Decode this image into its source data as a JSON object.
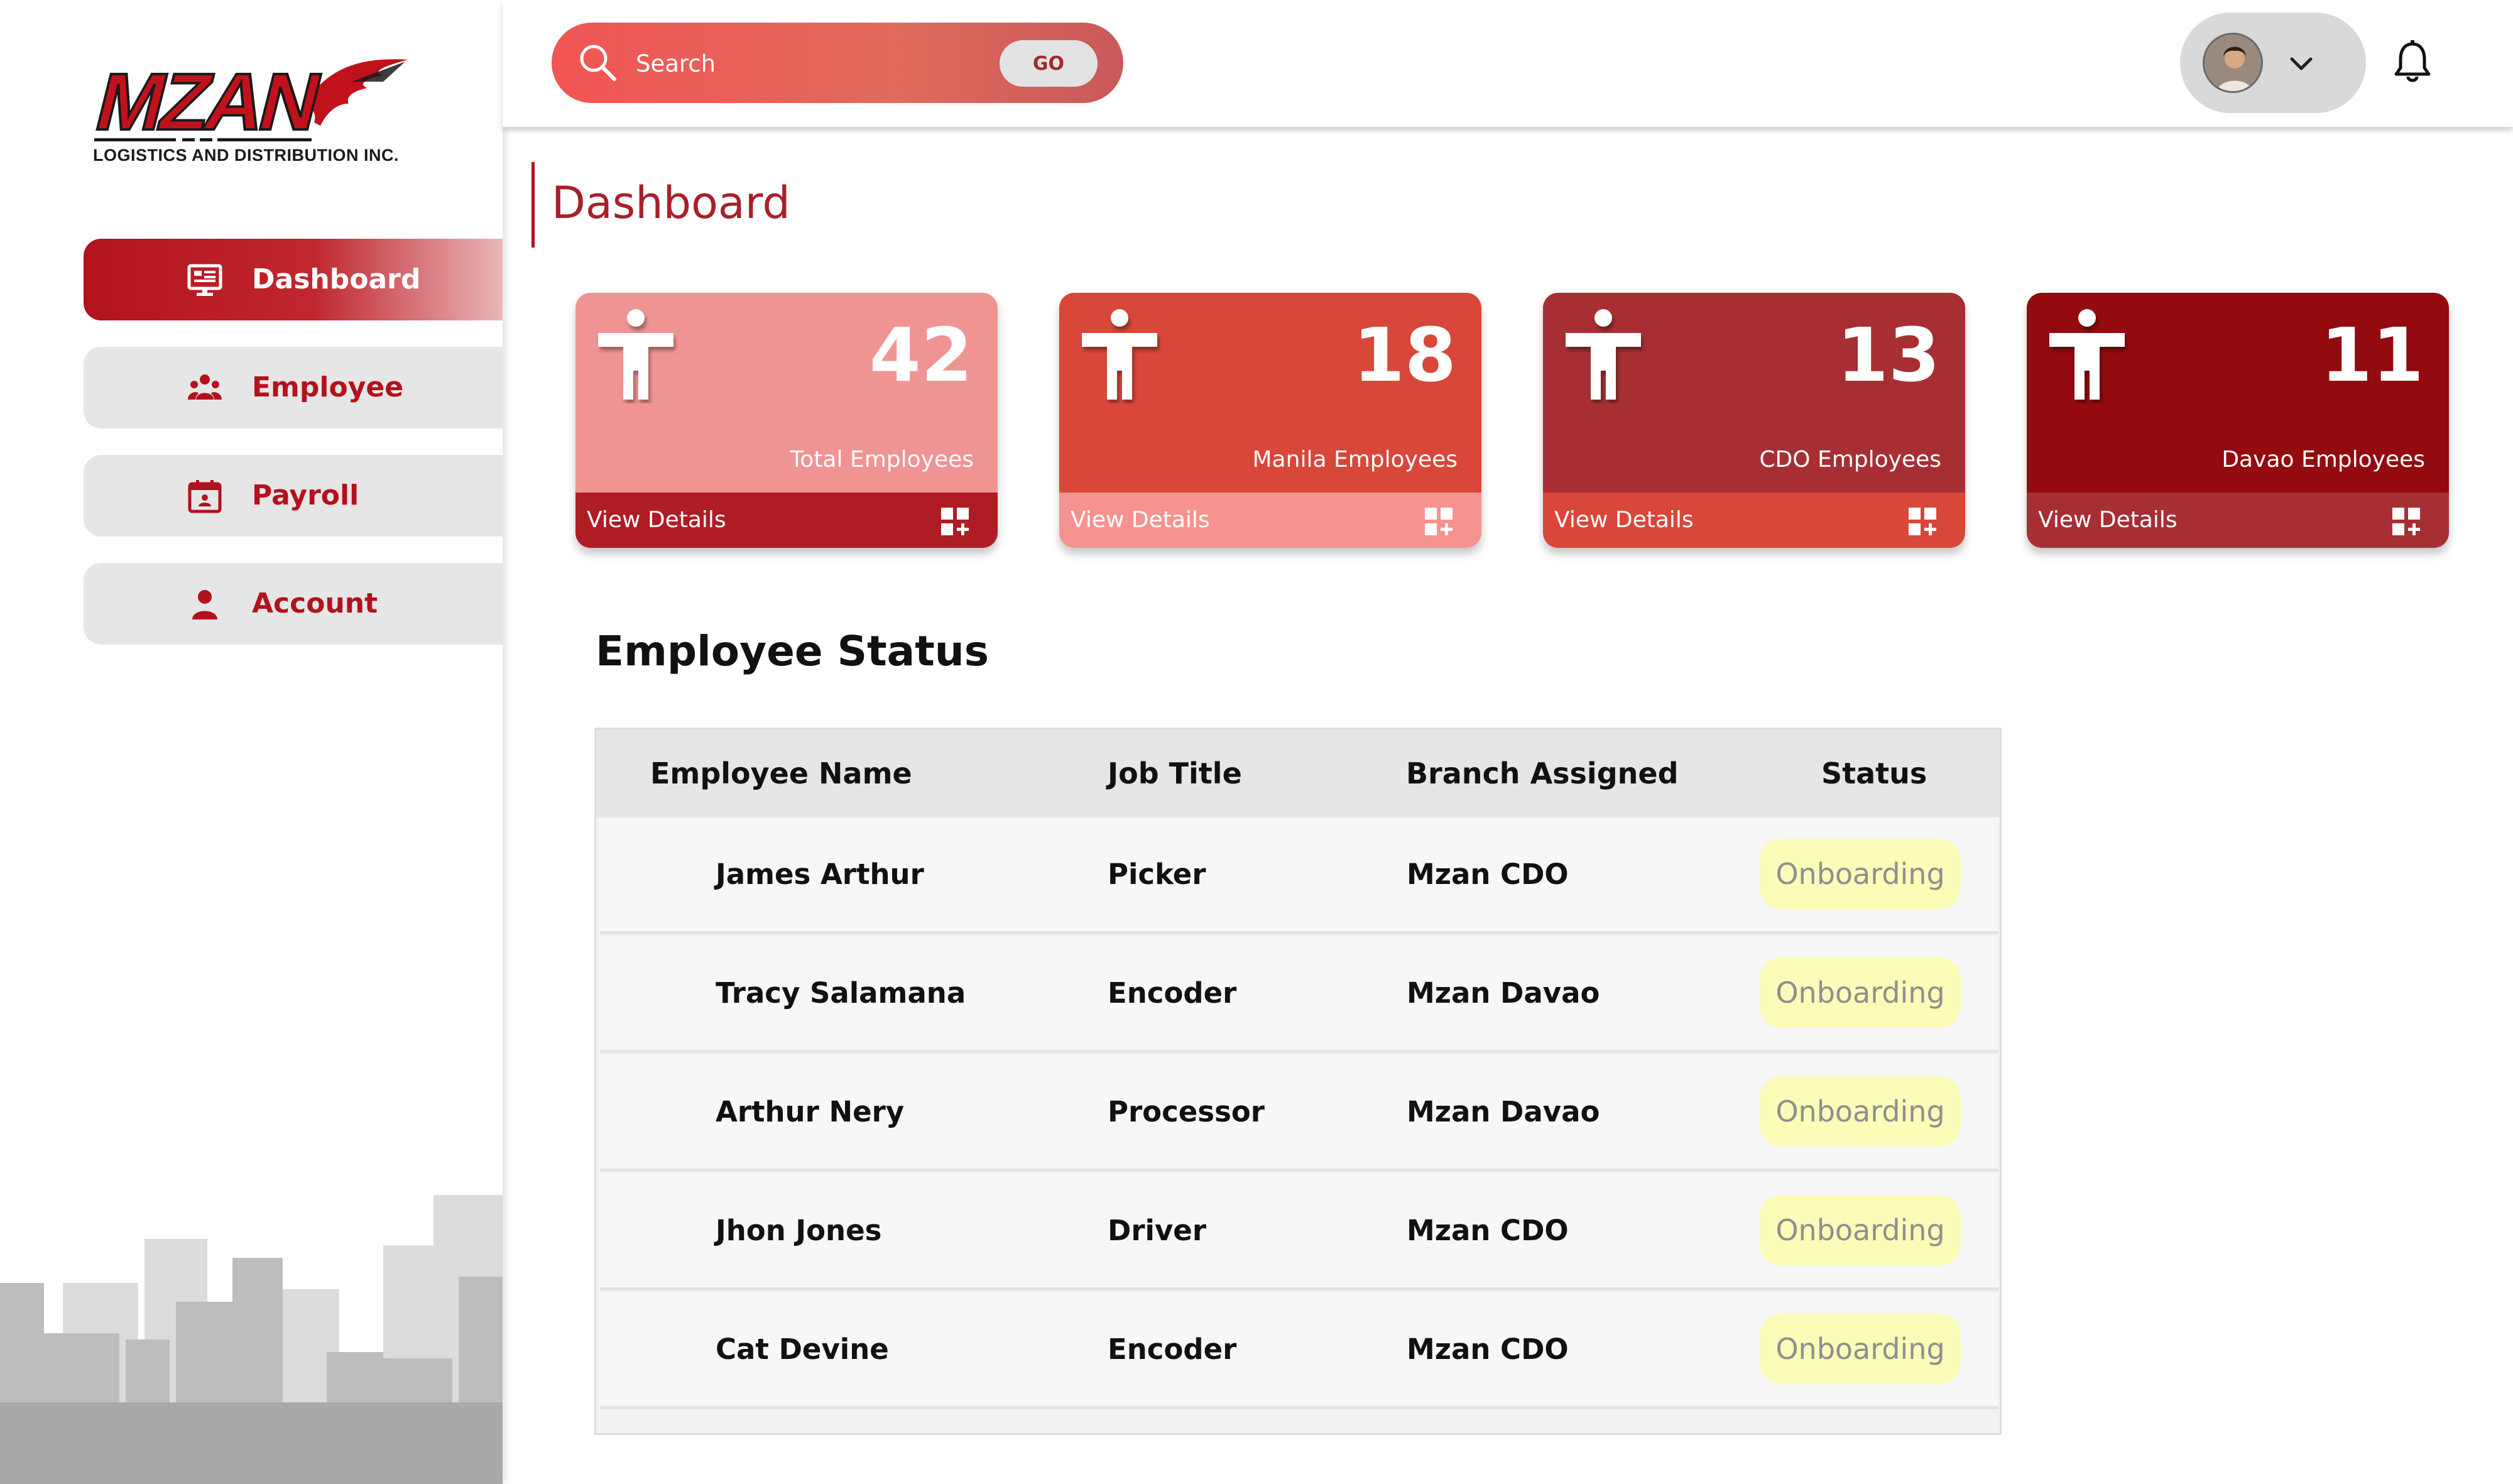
{
  "brand": {
    "name": "MZAN",
    "subtitle": "LOGISTICS AND DISTRIBUTION INC.",
    "accent": "#b3121d"
  },
  "sidebar": {
    "items": [
      {
        "label": "Dashboard",
        "icon": "monitor-icon",
        "active": true
      },
      {
        "label": "Employee",
        "icon": "group-icon",
        "active": false
      },
      {
        "label": "Payroll",
        "icon": "calendar-id-icon",
        "active": false
      },
      {
        "label": "Account",
        "icon": "person-icon",
        "active": false
      }
    ]
  },
  "header": {
    "search": {
      "placeholder": "Search",
      "value": "",
      "button_label": "GO",
      "icon": "search-icon"
    },
    "profile": {
      "avatar": "avatar",
      "menu_icon": "chevron-down-icon"
    },
    "notifications_icon": "bell-icon"
  },
  "page": {
    "title": "Dashboard"
  },
  "cards": [
    {
      "value": "42",
      "label": "Total Employees",
      "link": "View Details",
      "icon": "person-icon",
      "link_icon": "grid-add-icon",
      "top_color": "#f09493",
      "bottom_color": "#b01c24"
    },
    {
      "value": "18",
      "label": "Manila Employees",
      "link": "View Details",
      "icon": "person-icon",
      "link_icon": "grid-add-icon",
      "top_color": "#d9473a",
      "bottom_color": "#f7938f"
    },
    {
      "value": "13",
      "label": "CDO Employees",
      "link": "View Details",
      "icon": "person-icon",
      "link_icon": "grid-add-icon",
      "top_color": "#a72f34",
      "bottom_color": "#d9473a"
    },
    {
      "value": "11",
      "label": "Davao Employees",
      "link": "View Details",
      "icon": "person-icon",
      "link_icon": "grid-add-icon",
      "top_color": "#930a0f",
      "bottom_color": "#a72f34"
    }
  ],
  "employee_status": {
    "title": "Employee Status",
    "columns": [
      "Employee Name",
      "Job Title",
      "Branch Assigned",
      "Status"
    ],
    "rows": [
      {
        "name": "James Arthur",
        "job": "Picker",
        "branch": "Mzan CDO",
        "status": "Onboarding"
      },
      {
        "name": "Tracy Salamana",
        "job": "Encoder",
        "branch": "Mzan Davao",
        "status": "Onboarding"
      },
      {
        "name": "Arthur Nery",
        "job": "Processor",
        "branch": "Mzan Davao",
        "status": "Onboarding"
      },
      {
        "name": "Jhon Jones",
        "job": "Driver",
        "branch": "Mzan CDO",
        "status": "Onboarding"
      },
      {
        "name": "Cat Devine",
        "job": "Encoder",
        "branch": "Mzan CDO",
        "status": "Onboarding"
      }
    ],
    "status_color": "#fafcb7"
  }
}
